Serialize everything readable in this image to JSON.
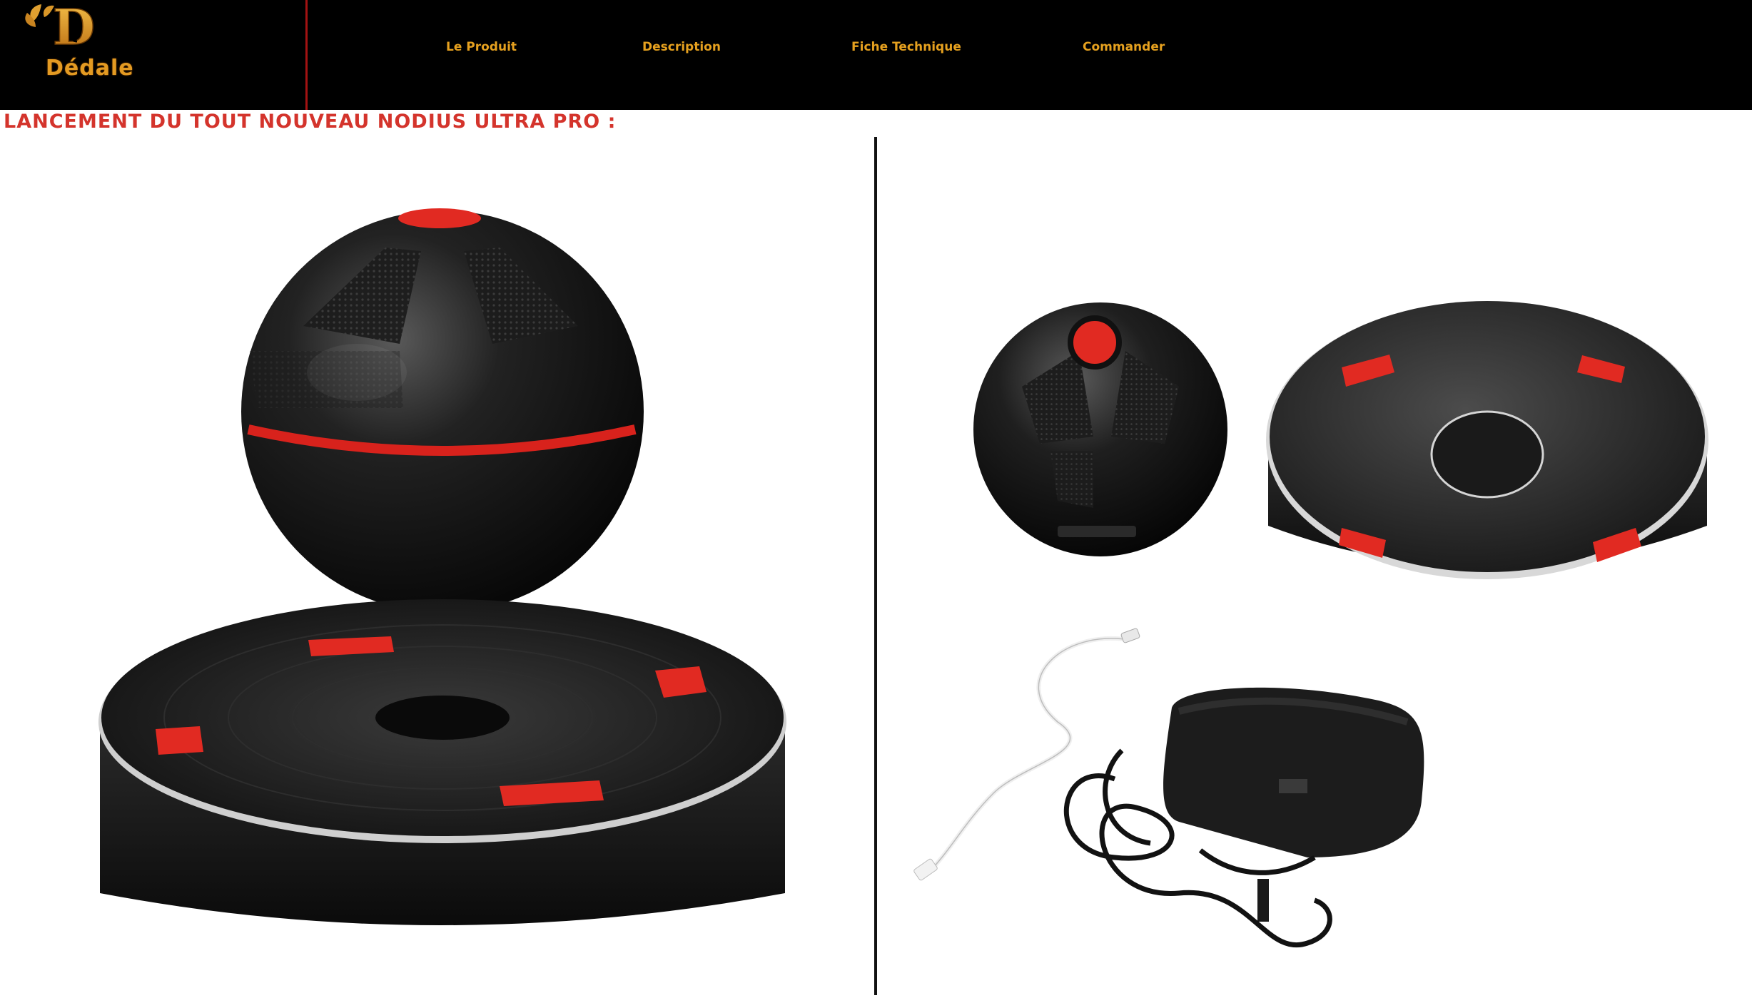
{
  "brand": {
    "name": "Dédale",
    "monogram": "D",
    "accent": "#e6a11f",
    "divider_color": "#a31212"
  },
  "nav": {
    "items": [
      {
        "label": "Le Produit"
      },
      {
        "label": "Description"
      },
      {
        "label": "Fiche Technique"
      },
      {
        "label": "Commander"
      }
    ]
  },
  "main": {
    "headline": "LANCEMENT DU TOUT NOUVEAU  NODIUS  ULTRA PRO :",
    "headline_color": "#d4342c"
  },
  "images": {
    "left": {
      "icon": "levitating-speaker-image"
    },
    "right": {
      "icon": "speaker-kit-contents-image"
    }
  }
}
